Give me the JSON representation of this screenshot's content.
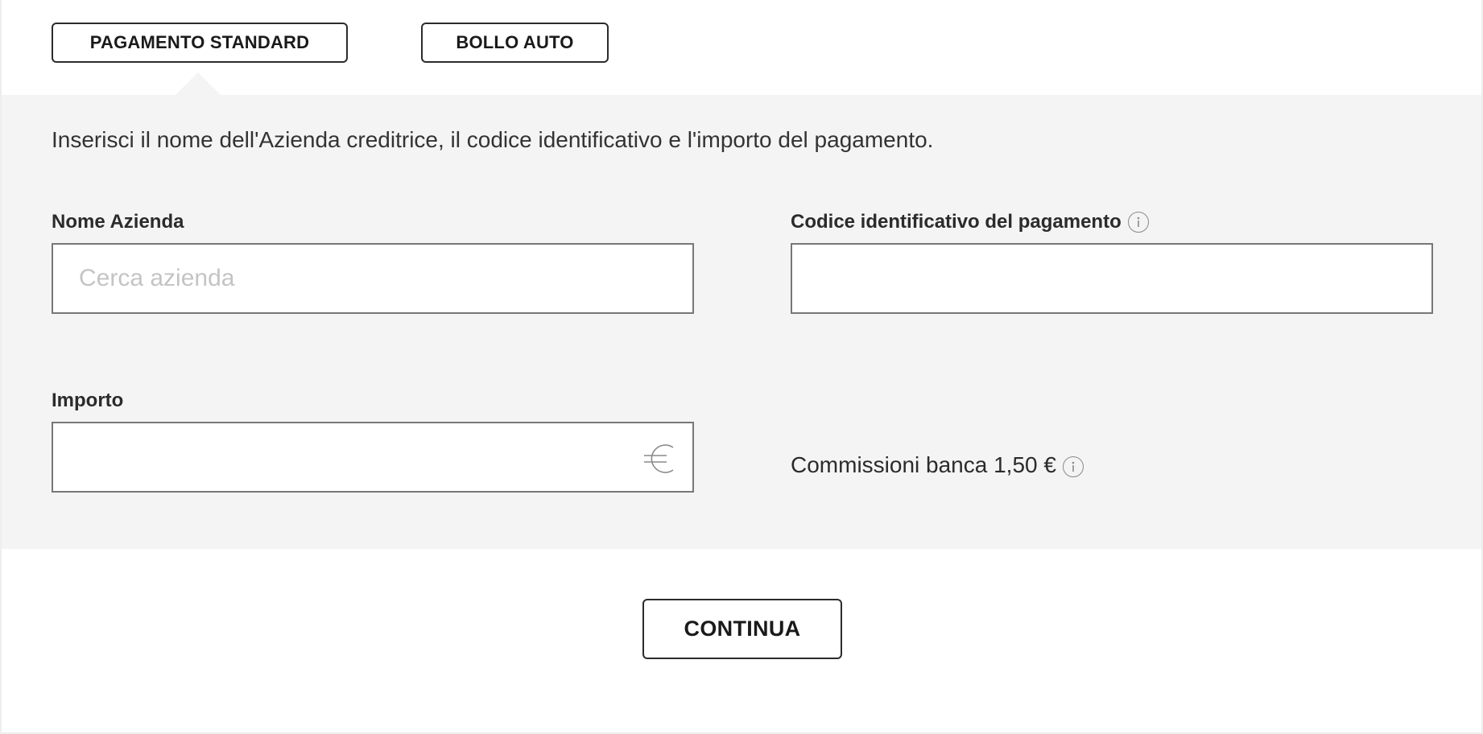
{
  "tabs": [
    {
      "label": "PAGAMENTO STANDARD",
      "selected": true
    },
    {
      "label": "BOLLO AUTO",
      "selected": false
    }
  ],
  "panel": {
    "intro": "Inserisci il nome dell'Azienda creditrice, il codice identificativo e l'importo del pagamento."
  },
  "form": {
    "nome_azienda": {
      "label": "Nome Azienda",
      "placeholder": "Cerca azienda",
      "value": ""
    },
    "codice": {
      "label": "Codice identificativo del pagamento",
      "value": "",
      "info_icon": "info-icon"
    },
    "importo": {
      "label": "Importo",
      "value": "",
      "currency_icon": "euro-icon"
    },
    "commissioni": {
      "text": "Commissioni banca 1,50 €",
      "info_icon": "info-icon"
    }
  },
  "actions": {
    "continue_label": "CONTINUA"
  },
  "colors": {
    "panel_background": "#f4f4f4",
    "border": "#2b2b2b",
    "input_border": "#777777",
    "placeholder": "#c4c4c4"
  }
}
